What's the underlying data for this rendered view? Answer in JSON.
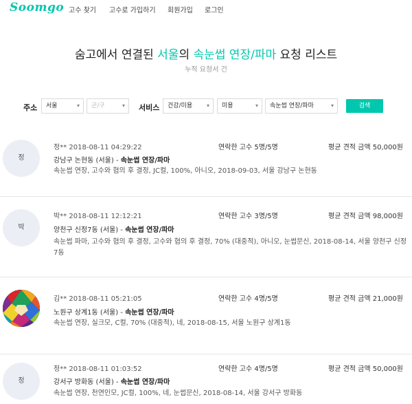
{
  "nav": {
    "logo": "Soomgo",
    "links": [
      "고수 찾기",
      "고수로 가입하기",
      "회원가입",
      "로그인"
    ]
  },
  "title": {
    "prefix": "숨고에서 연결된 ",
    "city": "서울",
    "mid": "의 ",
    "service": "속눈썹 연장/파마",
    "suffix": " 요청 리스트",
    "subtitle": "누적 요청서 건"
  },
  "filters": {
    "address_label": "주소",
    "city_value": "서울",
    "district_placeholder": "군/구",
    "service_label": "서비스",
    "category_value": "건강/미용",
    "subcategory_value": "미용",
    "service_value": "속눈썹 연장/파마",
    "search_label": "검색"
  },
  "requests": [
    {
      "avatar_text": "정",
      "name": "정**",
      "datetime": "2018-08-11 04:29:22",
      "contact": "연락한 고수 5명/5명",
      "price": "평균 견적 금액 50,000원",
      "location": "강남구 논현동 (서울)",
      "service": "속눈썹 연장/파마",
      "description": "속눈썹 연장, 고수와 협의 후 결정, JC컬, 100%, 아니오, 2018-09-03, 서울 강남구 논현동"
    },
    {
      "avatar_text": "박",
      "name": "박**",
      "datetime": "2018-08-11 12:12:21",
      "contact": "연락한 고수 3명/5명",
      "price": "평균 견적 금액 98,000원",
      "location": "양천구 신정7동 (서울)",
      "service": "속눈썹 연장/파마",
      "description": "속눈썹 파마, 고수와 협의 후 결정, 고수와 협의 후 결정, 70% (대중적), 아니오, 눈썹문신, 2018-08-14, 서울 양천구 신정7동"
    },
    {
      "avatar_text": "",
      "name": "김**",
      "datetime": "2018-08-11 05:21:05",
      "contact": "연락한 고수 4명/5명",
      "price": "평균 견적 금액 21,000원",
      "location": "노원구 상계1동 (서울)",
      "service": "속눈썹 연장/파마",
      "description": "속눈썹 연장, 실크모, C컬, 70% (대중적), 네, 2018-08-15, 서울 노원구 상계1동"
    },
    {
      "avatar_text": "정",
      "name": "정**",
      "datetime": "2018-08-11 01:03:52",
      "contact": "연락한 고수 4명/5명",
      "price": "평균 견적 금액 50,000원",
      "location": "강서구 방화동 (서울)",
      "service": "속눈썹 연장/파마",
      "description": "속눈썹 연장, 천연인모, JC컬, 100%, 네, 눈썹문신, 2018-08-14, 서울 강서구 방화동"
    }
  ],
  "colors": {
    "accent": "#00c7ae",
    "avatar_bg": "#eceef5"
  }
}
